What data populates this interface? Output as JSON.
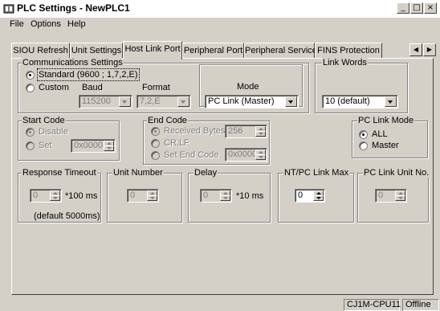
{
  "window": {
    "title": "PLC Settings - NewPLC1",
    "minimize": "_",
    "maximize": "□",
    "close": "×"
  },
  "menu": [
    "File",
    "Options",
    "Help"
  ],
  "tabs": [
    "SIOU Refresh",
    "Unit Settings",
    "Host Link Port",
    "Peripheral Port",
    "Peripheral Service",
    "FINS Protection"
  ],
  "active_tab": "Host Link Port",
  "comm": {
    "legend": "Communications Settings",
    "standard_label": "Standard (9600 ; 1,7,2,E)",
    "custom_label": "Custom",
    "baud_label": "Baud",
    "baud_value": "115200",
    "format_label": "Format",
    "format_value": "7,2,E",
    "mode_label": "Mode",
    "mode_value": "PC Link (Master)"
  },
  "link_words": {
    "legend": "Link Words",
    "value": "10 (default)"
  },
  "start_code": {
    "legend": "Start Code",
    "disable_label": "Disable",
    "set_label": "Set",
    "value": "0x0000"
  },
  "end_code": {
    "legend": "End Code",
    "received_label": "Received Bytes",
    "received_value": "256",
    "crlf_label": "CR,LF",
    "set_end_label": "Set End Code",
    "set_end_value": "0x0000"
  },
  "pc_link_mode": {
    "legend": "PC Link Mode",
    "all_label": "ALL",
    "master_label": "Master"
  },
  "response_timeout": {
    "legend": "Response Timeout",
    "value": "0",
    "unit": "*100 ms",
    "note": "(default 5000ms)"
  },
  "unit_number": {
    "legend": "Unit Number",
    "value": "0"
  },
  "delay": {
    "legend": "Delay",
    "value": "0",
    "unit": "*10 ms"
  },
  "nt_pc_link_max": {
    "legend": "NT/PC Link Max",
    "value": "0"
  },
  "pc_link_unit_no": {
    "legend": "PC Link Unit No.",
    "value": "0"
  },
  "status": {
    "cpu": "CJ1M-CPU11",
    "state": "Offline"
  }
}
